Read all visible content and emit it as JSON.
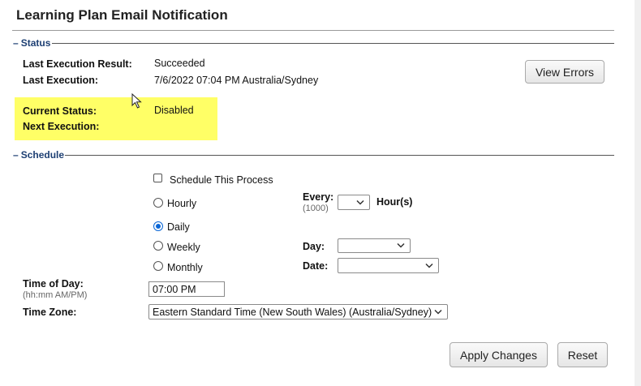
{
  "header": {
    "title": "Learning Plan Email Notification"
  },
  "status": {
    "legend": "Status",
    "last_result_label": "Last Execution Result:",
    "last_result_value": "Succeeded",
    "last_execution_label": "Last Execution:",
    "last_execution_value": "7/6/2022 07:04 PM Australia/Sydney",
    "current_status_label": "Current Status:",
    "current_status_value": "Disabled",
    "next_execution_label": "Next Execution:",
    "next_execution_value": "",
    "view_errors_label": "View Errors",
    "highlight_color": "#ffff66"
  },
  "schedule": {
    "legend": "Schedule",
    "schedule_process_label": "Schedule This Process",
    "schedule_process_checked": false,
    "frequency_options": [
      {
        "label": "Hourly",
        "selected": false
      },
      {
        "label": "Daily",
        "selected": true
      },
      {
        "label": "Weekly",
        "selected": false
      },
      {
        "label": "Monthly",
        "selected": false
      }
    ],
    "every_label": "Every:",
    "every_hint": "(1000)",
    "every_value": "",
    "hours_label": "Hour(s)",
    "day_label": "Day:",
    "day_value": "",
    "date_label": "Date:",
    "date_value": "",
    "time_of_day_label": "Time of Day:",
    "time_of_day_hint": "(hh:mm AM/PM)",
    "time_of_day_value": "07:00 PM",
    "time_zone_label": "Time Zone:",
    "time_zone_value": "Eastern Standard Time (New South Wales) (Australia/Sydney)"
  },
  "actions": {
    "apply_label": "Apply Changes",
    "reset_label": "Reset"
  },
  "colors": {
    "legend_text": "#1d3f73",
    "radio_selected": "#0a66d6"
  }
}
